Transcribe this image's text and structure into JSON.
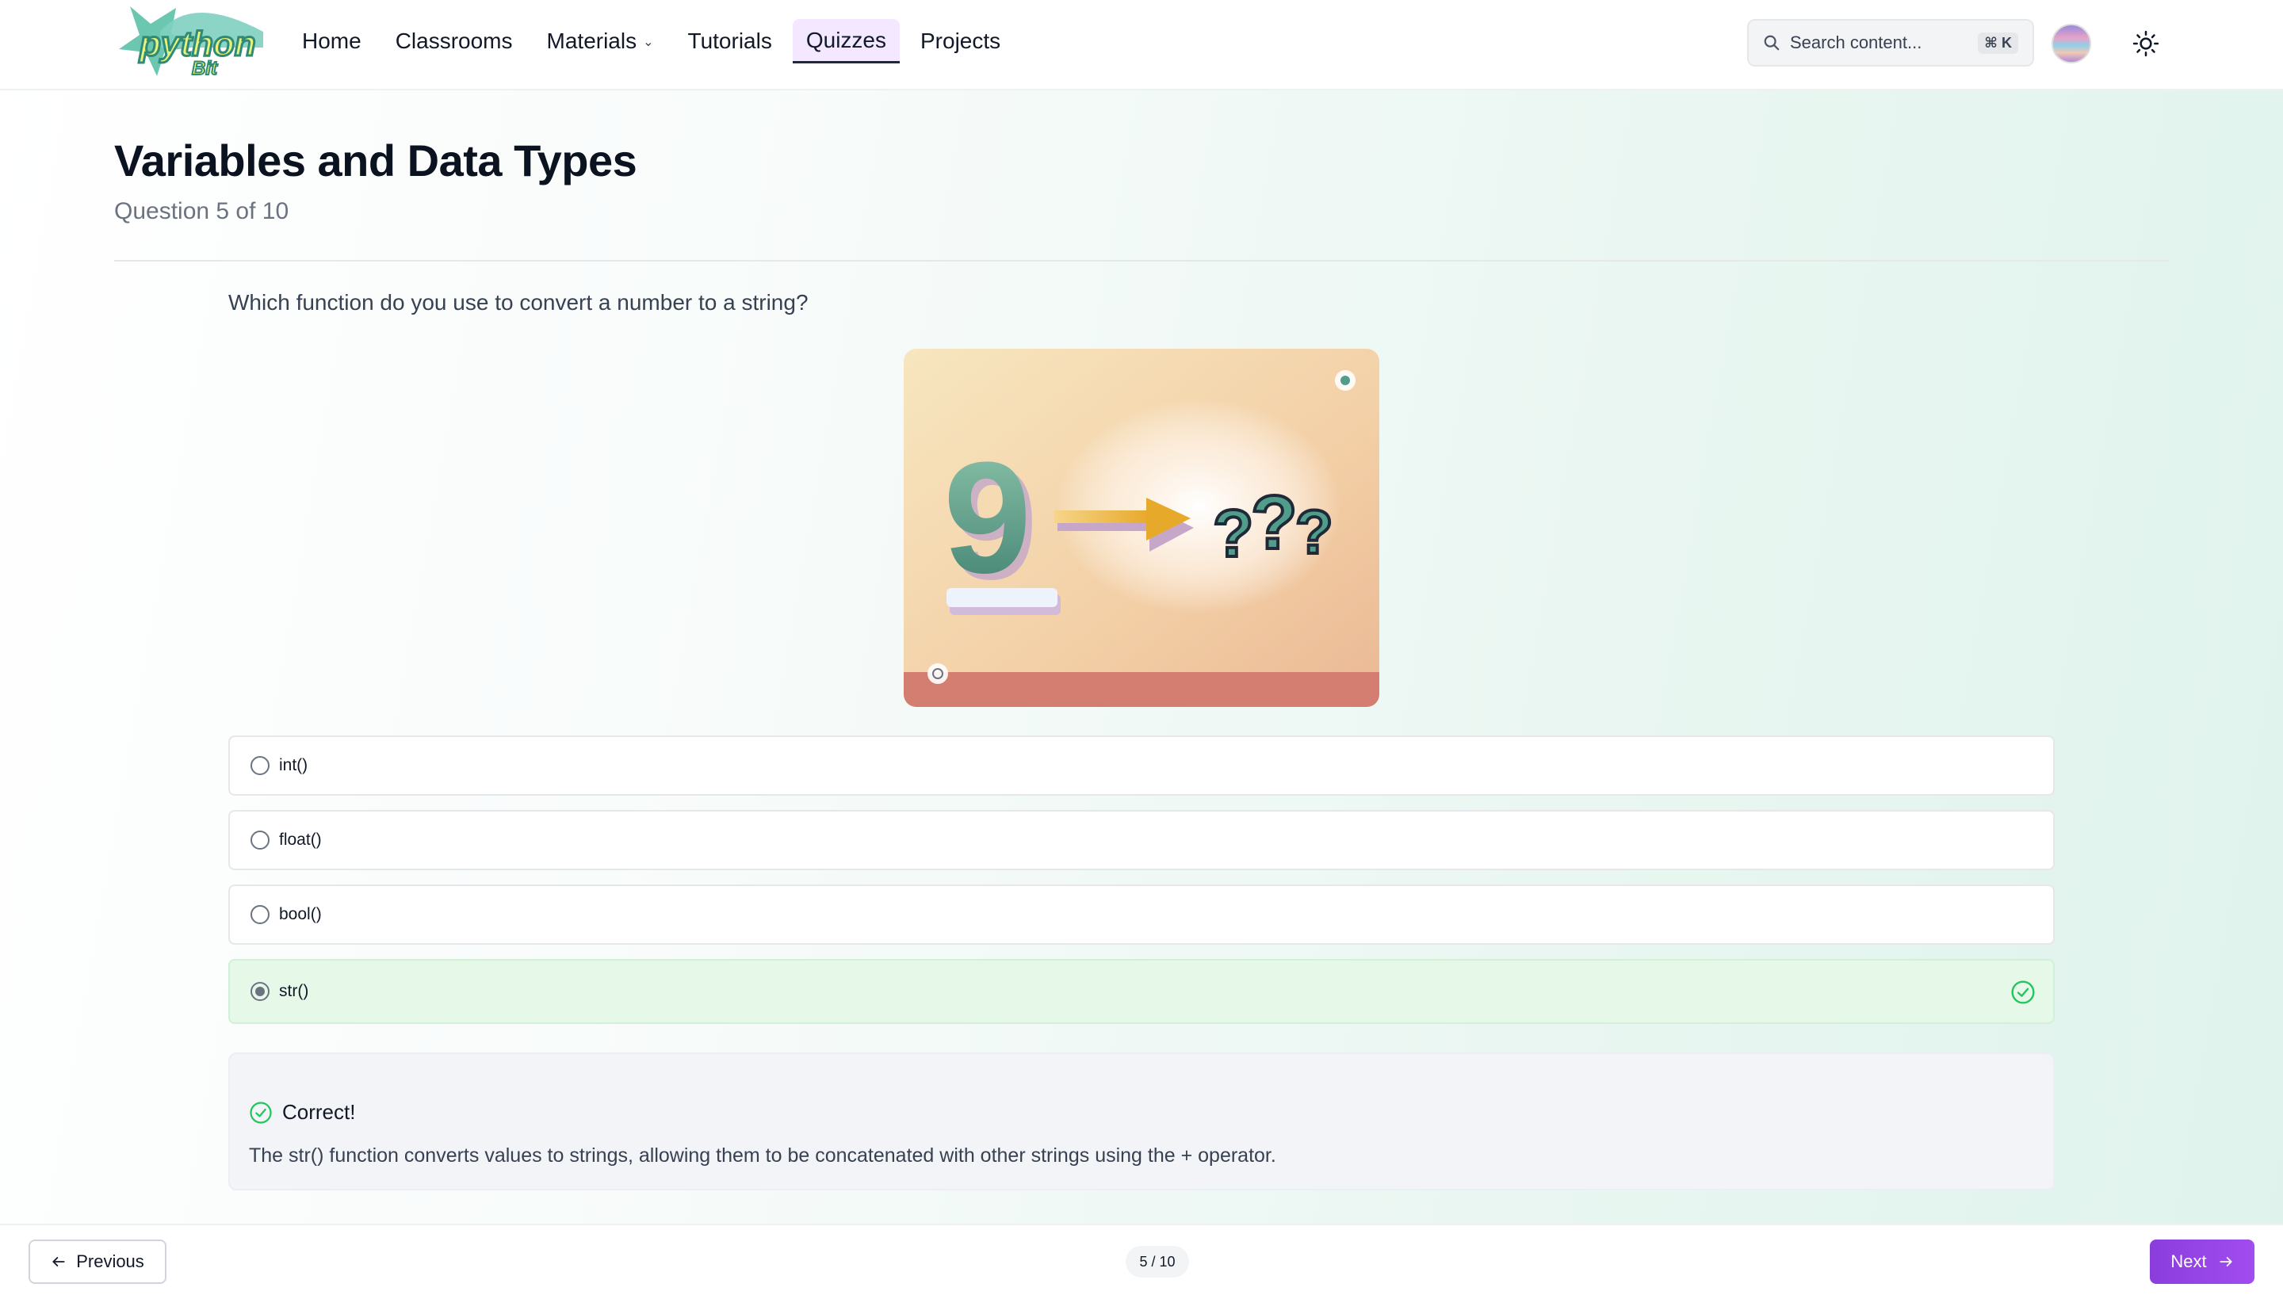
{
  "header": {
    "logo_text": "python",
    "logo_subtext": "Bit",
    "nav": [
      {
        "label": "Home",
        "active": false
      },
      {
        "label": "Classrooms",
        "active": false
      },
      {
        "label": "Materials",
        "active": false,
        "has_dropdown": true
      },
      {
        "label": "Tutorials",
        "active": false
      },
      {
        "label": "Quizzes",
        "active": true
      },
      {
        "label": "Projects",
        "active": false
      }
    ],
    "search": {
      "placeholder": "Search content...",
      "shortcut": "⌘ K",
      "icon": "search-icon"
    },
    "theme_toggle_icon": "sun-icon"
  },
  "quiz": {
    "title": "Variables and Data Types",
    "progress": "Question 5 of 10",
    "question": "Which function do you use to convert a number to a string?",
    "options": [
      {
        "label": "int()",
        "selected": false
      },
      {
        "label": "float()",
        "selected": false
      },
      {
        "label": "bool()",
        "selected": false
      },
      {
        "label": "str()",
        "selected": true,
        "correct": true
      }
    ],
    "feedback": {
      "title": "Correct!",
      "text": "The str() function converts values to strings, allowing them to be concatenated with other strings using the + operator."
    }
  },
  "footer": {
    "previous_label": "Previous",
    "pager": "5 / 10",
    "next_label": "Next"
  },
  "colors": {
    "accent": "#9a45e8",
    "correct_bg": "#e6f9e8",
    "correct_icon": "#22c55e"
  }
}
